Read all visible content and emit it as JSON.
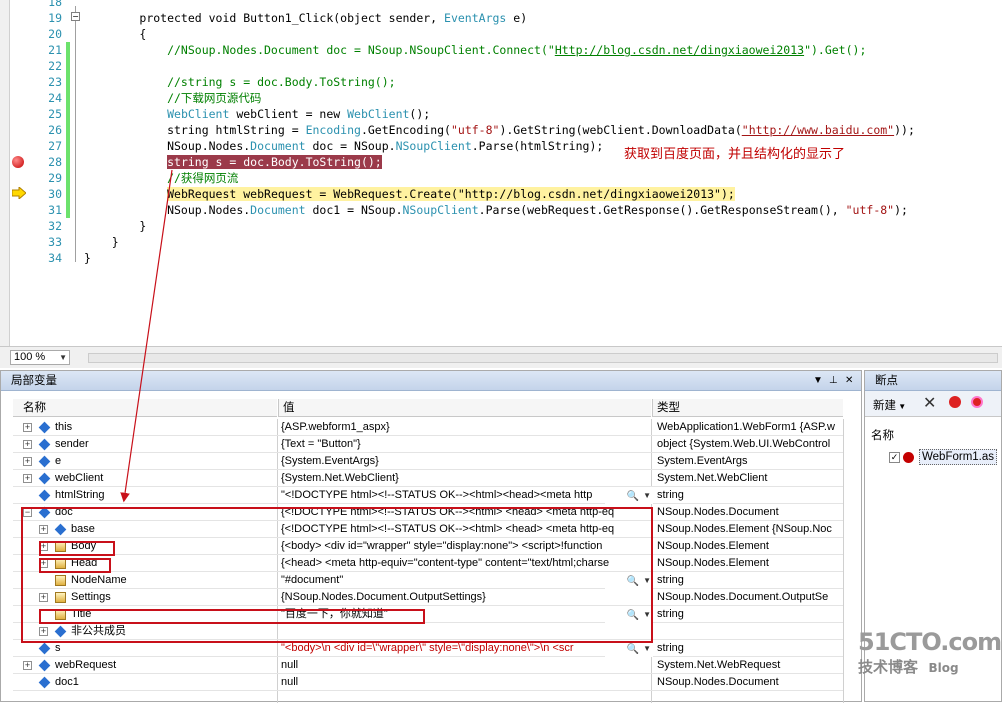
{
  "editor": {
    "lines": [
      {
        "n": "18",
        "tokens": []
      },
      {
        "n": "19",
        "tokens": [
          {
            "t": "        "
          },
          {
            "t": "protected void Button1_Click(object sender, "
          },
          {
            "t": "EventArgs",
            "c": "ty"
          },
          {
            "t": " e)"
          }
        ]
      },
      {
        "n": "20",
        "tokens": [
          {
            "t": "        {"
          }
        ]
      },
      {
        "n": "21",
        "tokens": [
          {
            "t": "            //NSoup.Nodes.Document doc = NSoup.NSoupClient.Connect(\"",
            "c": "cm"
          },
          {
            "t": "Http://blog.csdn.net/dingxiaowei2013",
            "c": "cm ul"
          },
          {
            "t": "\").Get();",
            "c": "cm"
          }
        ]
      },
      {
        "n": "22",
        "tokens": []
      },
      {
        "n": "23",
        "tokens": [
          {
            "t": "            //string s = doc.Body.ToString();",
            "c": "cm"
          }
        ]
      },
      {
        "n": "24",
        "tokens": [
          {
            "t": "            //下载网页源代码",
            "c": "cm"
          }
        ]
      },
      {
        "n": "25",
        "tokens": [
          {
            "t": "            "
          },
          {
            "t": "WebClient",
            "c": "ty"
          },
          {
            "t": " webClient = new "
          },
          {
            "t": "WebClient",
            "c": "ty"
          },
          {
            "t": "();"
          }
        ]
      },
      {
        "n": "26",
        "tokens": [
          {
            "t": "            string htmlString = "
          },
          {
            "t": "Encoding",
            "c": "ty"
          },
          {
            "t": ".GetEncoding("
          },
          {
            "t": "\"utf-8\"",
            "c": "st"
          },
          {
            "t": ").GetString(webClient.DownloadData("
          },
          {
            "t": "\"http://www.baidu.com\"",
            "c": "st ul"
          },
          {
            "t": "));"
          }
        ]
      },
      {
        "n": "27",
        "tokens": [
          {
            "t": "            NSoup.Nodes."
          },
          {
            "t": "Document",
            "c": "ty"
          },
          {
            "t": " doc = NSoup."
          },
          {
            "t": "NSoupClient",
            "c": "ty"
          },
          {
            "t": ".Parse(htmlString);"
          }
        ]
      },
      {
        "n": "28",
        "tokens": [
          {
            "t": "            "
          },
          {
            "t": "string s = doc.Body.ToString();",
            "c": "hl-red"
          }
        ]
      },
      {
        "n": "29",
        "tokens": [
          {
            "t": "            //获得网页流",
            "c": "cm"
          }
        ]
      },
      {
        "n": "30",
        "tokens": [
          {
            "t": "            "
          },
          {
            "t": "WebRequest webRequest = WebRequest.Create(\"http://blog.csdn.net/dingxiaowei2013\");",
            "c": "hl-yel"
          }
        ]
      },
      {
        "n": "31",
        "tokens": [
          {
            "t": "            NSoup.Nodes."
          },
          {
            "t": "Document",
            "c": "ty"
          },
          {
            "t": " doc1 = NSoup."
          },
          {
            "t": "NSoupClient",
            "c": "ty"
          },
          {
            "t": ".Parse(webRequest.GetResponse().GetResponseStream(), "
          },
          {
            "t": "\"utf-8\"",
            "c": "st"
          },
          {
            "t": ");"
          }
        ]
      },
      {
        "n": "32",
        "tokens": [
          {
            "t": "        }"
          }
        ]
      },
      {
        "n": "33",
        "tokens": [
          {
            "t": "    }"
          }
        ]
      },
      {
        "n": "34",
        "tokens": [
          {
            "t": "}"
          }
        ]
      }
    ],
    "annotation": "获取到百度页面，并且结构化的显示了",
    "zoom": "100 %"
  },
  "locals": {
    "title": "局部变量",
    "headers": {
      "name": "名称",
      "value": "值",
      "type": "类型"
    },
    "rows": [
      {
        "name": "this",
        "value": "{ASP.webform1_aspx}",
        "type": "WebApplication1.WebForm1 {ASP.w"
      },
      {
        "name": "sender",
        "value": "{Text = \"Button\"}",
        "type": "object {System.Web.UI.WebControl"
      },
      {
        "name": "e",
        "value": "{System.EventArgs}",
        "type": "System.EventArgs"
      },
      {
        "name": "webClient",
        "value": "{System.Net.WebClient}",
        "type": "System.Net.WebClient"
      },
      {
        "name": "htmlString",
        "value": "\"<!DOCTYPE html><!--STATUS OK--><html><head><meta http",
        "type": "string"
      },
      {
        "name": "doc",
        "value": "{<!DOCTYPE html><!--STATUS OK--><html> <head>  <meta http-eq",
        "type": "NSoup.Nodes.Document"
      },
      {
        "name": "base",
        "value": "{<!DOCTYPE html><!--STATUS OK--><html> <head>  <meta http-eq",
        "type": "NSoup.Nodes.Element {NSoup.Noc"
      },
      {
        "name": "Body",
        "value": "{<body> <div id=\"wrapper\" style=\"display:none\">  <script>!function",
        "type": "NSoup.Nodes.Element"
      },
      {
        "name": "Head",
        "value": "{<head> <meta http-equiv=\"content-type\" content=\"text/html;charse",
        "type": "NSoup.Nodes.Element"
      },
      {
        "name": "NodeName",
        "value": "\"#document\"",
        "type": "string"
      },
      {
        "name": "Settings",
        "value": "{NSoup.Nodes.Document.OutputSettings}",
        "type": "NSoup.Nodes.Document.OutputSe"
      },
      {
        "name": "Title",
        "value": "\"百度一下，你就知道\"",
        "type": "string"
      },
      {
        "name": "非公共成员",
        "value": "",
        "type": ""
      },
      {
        "name": "s",
        "value": "\"<body>\\n <div id=\\\"wrapper\\\" style=\\\"display:none\\\">\\n  <scr",
        "type": "string"
      },
      {
        "name": "webRequest",
        "value": "null",
        "type": "System.Net.WebRequest"
      },
      {
        "name": "doc1",
        "value": "null",
        "type": "NSoup.Nodes.Document"
      }
    ]
  },
  "breakpoints": {
    "title": "断点",
    "new_label": "新建",
    "column": "名称",
    "items": [
      {
        "label": "WebForm1.as",
        "checked": true
      }
    ]
  },
  "watermark": {
    "logo": "51CTO.com",
    "sub": "技术博客",
    "blog": "Blog"
  },
  "colors": {
    "breakpoint": "#c40000",
    "current_line": "#fff2a0",
    "annotation": "#c00000",
    "box": "#c8101a"
  }
}
